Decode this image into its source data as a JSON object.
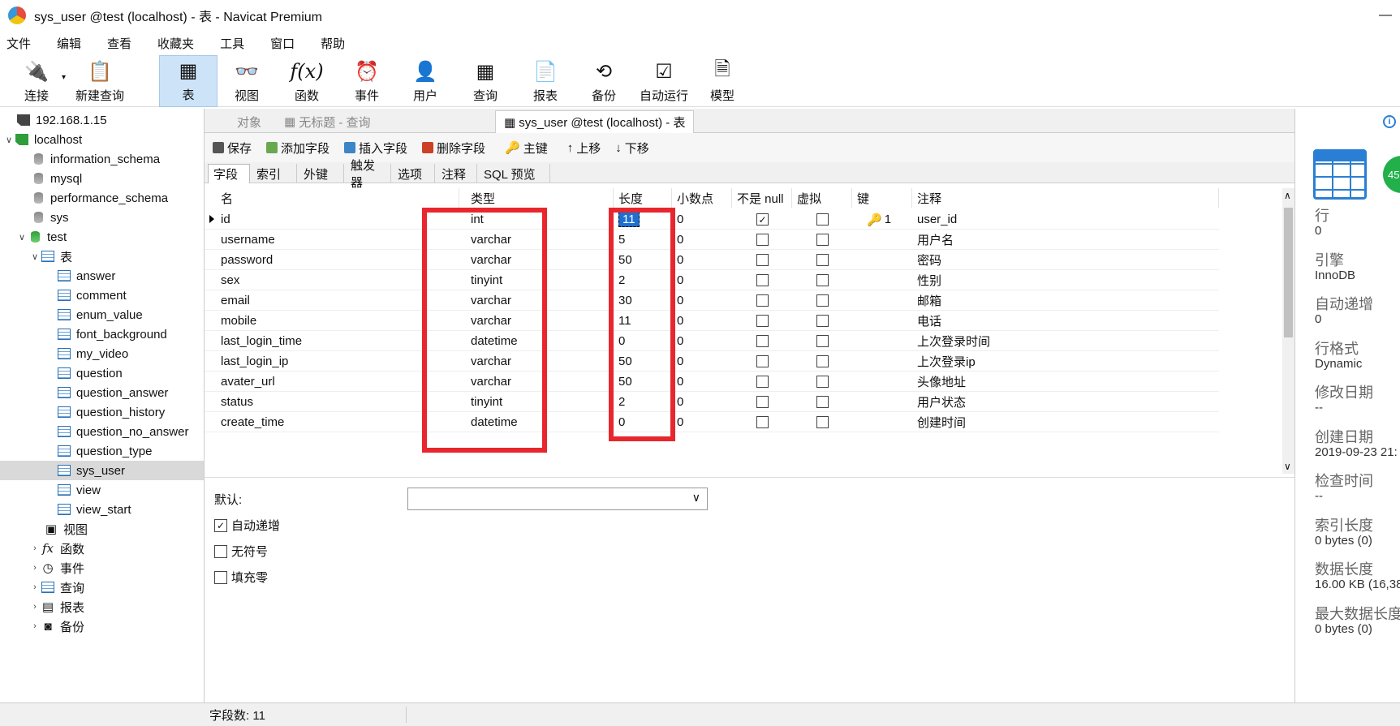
{
  "window": {
    "title": "sys_user @test (localhost) - 表 - Navicat Premium"
  },
  "menu": [
    "文件",
    "编辑",
    "查看",
    "收藏夹",
    "工具",
    "窗口",
    "帮助"
  ],
  "toolbar": [
    {
      "label": "连接",
      "icon": "plug-icon"
    },
    {
      "label": "新建查询",
      "icon": "new-query-icon"
    },
    {
      "label": "表",
      "icon": "table-icon"
    },
    {
      "label": "视图",
      "icon": "view-icon"
    },
    {
      "label": "函数",
      "icon": "function-icon"
    },
    {
      "label": "事件",
      "icon": "clock-icon"
    },
    {
      "label": "用户",
      "icon": "user-icon"
    },
    {
      "label": "查询",
      "icon": "query-icon"
    },
    {
      "label": "报表",
      "icon": "report-icon"
    },
    {
      "label": "备份",
      "icon": "backup-icon"
    },
    {
      "label": "自动运行",
      "icon": "autorun-icon"
    },
    {
      "label": "模型",
      "icon": "model-icon"
    }
  ],
  "tree": {
    "conn1": "192.168.1.15",
    "conn2": "localhost",
    "dbs": [
      "information_schema",
      "mysql",
      "performance_schema",
      "sys",
      "test"
    ],
    "tables_folder": "表",
    "tables": [
      "answer",
      "comment",
      "enum_value",
      "font_background",
      "my_video",
      "question",
      "question_answer",
      "question_history",
      "question_no_answer",
      "question_type",
      "sys_user",
      "view",
      "view_start"
    ],
    "folders": [
      "视图",
      "函数",
      "事件",
      "查询",
      "报表",
      "备份"
    ]
  },
  "tabs": [
    "对象",
    "无标题 - 查询",
    "sys_user @test (localhost) - 表"
  ],
  "design_toolbar": [
    "保存",
    "添加字段",
    "插入字段",
    "删除字段",
    "主键",
    "上移",
    "下移"
  ],
  "subtabs": [
    "字段",
    "索引",
    "外键",
    "触发器",
    "选项",
    "注释",
    "SQL 预览"
  ],
  "columns": [
    "名",
    "类型",
    "长度",
    "小数点",
    "不是 null",
    "虚拟",
    "键",
    "注释"
  ],
  "fields": [
    {
      "name": "id",
      "type": "int",
      "length": "11",
      "decimals": "0",
      "notnull": true,
      "virtual": false,
      "key": "1",
      "comment": "user_id"
    },
    {
      "name": "username",
      "type": "varchar",
      "length": "5",
      "decimals": "0",
      "notnull": false,
      "virtual": false,
      "key": "",
      "comment": "用户名"
    },
    {
      "name": "password",
      "type": "varchar",
      "length": "50",
      "decimals": "0",
      "notnull": false,
      "virtual": false,
      "key": "",
      "comment": "密码"
    },
    {
      "name": "sex",
      "type": "tinyint",
      "length": "2",
      "decimals": "0",
      "notnull": false,
      "virtual": false,
      "key": "",
      "comment": "性别"
    },
    {
      "name": "email",
      "type": "varchar",
      "length": "30",
      "decimals": "0",
      "notnull": false,
      "virtual": false,
      "key": "",
      "comment": "邮箱"
    },
    {
      "name": "mobile",
      "type": "varchar",
      "length": "11",
      "decimals": "0",
      "notnull": false,
      "virtual": false,
      "key": "",
      "comment": "电话"
    },
    {
      "name": "last_login_time",
      "type": "datetime",
      "length": "0",
      "decimals": "0",
      "notnull": false,
      "virtual": false,
      "key": "",
      "comment": "上次登录时间"
    },
    {
      "name": "last_login_ip",
      "type": "varchar",
      "length": "50",
      "decimals": "0",
      "notnull": false,
      "virtual": false,
      "key": "",
      "comment": "上次登录ip"
    },
    {
      "name": "avater_url",
      "type": "varchar",
      "length": "50",
      "decimals": "0",
      "notnull": false,
      "virtual": false,
      "key": "",
      "comment": "头像地址"
    },
    {
      "name": "status",
      "type": "tinyint",
      "length": "2",
      "decimals": "0",
      "notnull": false,
      "virtual": false,
      "key": "",
      "comment": "用户状态"
    },
    {
      "name": "create_time",
      "type": "datetime",
      "length": "0",
      "decimals": "0",
      "notnull": false,
      "virtual": false,
      "key": "",
      "comment": "创建时间"
    }
  ],
  "props": {
    "default_label": "默认:",
    "auto_increment": "自动递增",
    "unsigned": "无符号",
    "zerofill": "填充零"
  },
  "info": {
    "badge": "45",
    "items": [
      {
        "label": "行",
        "value": "0"
      },
      {
        "label": "引擎",
        "value": "InnoDB"
      },
      {
        "label": "自动递增",
        "value": "0"
      },
      {
        "label": "行格式",
        "value": "Dynamic"
      },
      {
        "label": "修改日期",
        "value": "--"
      },
      {
        "label": "创建日期",
        "value": "2019-09-23 21:"
      },
      {
        "label": "检查时间",
        "value": "--"
      },
      {
        "label": "索引长度",
        "value": "0 bytes (0)"
      },
      {
        "label": "数据长度",
        "value": "16.00 KB (16,38"
      },
      {
        "label": "最大数据长度",
        "value": "0 bytes (0)"
      }
    ]
  },
  "status": "字段数: 11",
  "colors": {
    "highlight": "#e8262d",
    "selection": "#1e6fd0",
    "accent": "#2a7fd4"
  }
}
